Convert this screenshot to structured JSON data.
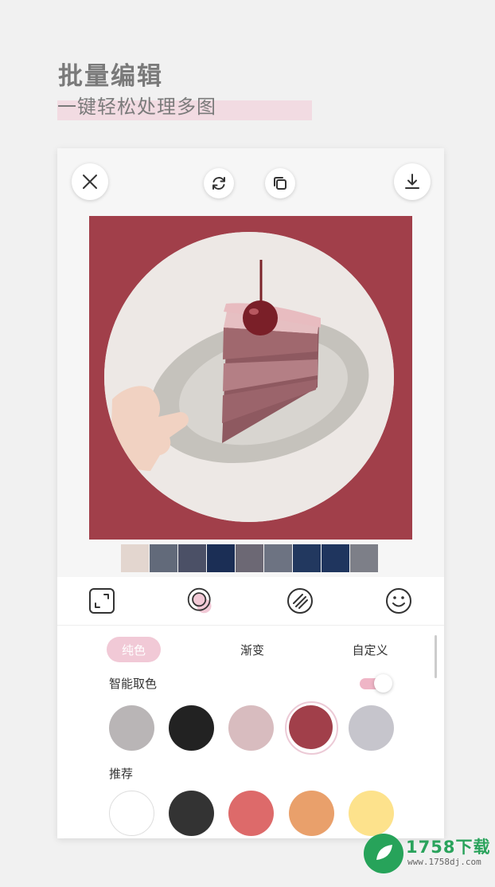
{
  "hero": {
    "title": "批量编辑",
    "subtitle": "一键轻松处理多图"
  },
  "topbar": {
    "close_icon": "close-icon",
    "rotate_icon": "rotate-icon",
    "duplicate_icon": "duplicate-icon",
    "download_icon": "download-icon"
  },
  "preview": {
    "background_color": "#a13f4a"
  },
  "thumbnails": [
    {
      "color": "#e3d6cf"
    },
    {
      "color": "#626a7a"
    },
    {
      "color": "#4b5066"
    },
    {
      "color": "#1b2e55"
    },
    {
      "color": "#6c6874"
    },
    {
      "color": "#6d7382"
    },
    {
      "color": "#22385f"
    },
    {
      "color": "#1f355e"
    },
    {
      "color": "#7d7f88"
    }
  ],
  "tools": [
    {
      "icon": "expand-icon"
    },
    {
      "icon": "ring-icon"
    },
    {
      "icon": "texture-icon"
    },
    {
      "icon": "smiley-icon"
    }
  ],
  "panel": {
    "tabs": [
      {
        "label": "纯色"
      },
      {
        "label": "渐变"
      },
      {
        "label": "自定义"
      }
    ],
    "smart_pick_label": "智能取色",
    "smart_pick_on": true,
    "smart_colors": [
      "#b9b5b6",
      "#222222",
      "#d8bcbf",
      "#a13f4a",
      "#c6c5cc"
    ],
    "recommend_label": "推荐",
    "recommend_colors": [
      "#ffffff",
      "#333333",
      "#dd6a6a",
      "#e9a06b",
      "#fde28c"
    ]
  },
  "watermark": {
    "brand": "1758下载",
    "url": "www.1758dj.com"
  }
}
